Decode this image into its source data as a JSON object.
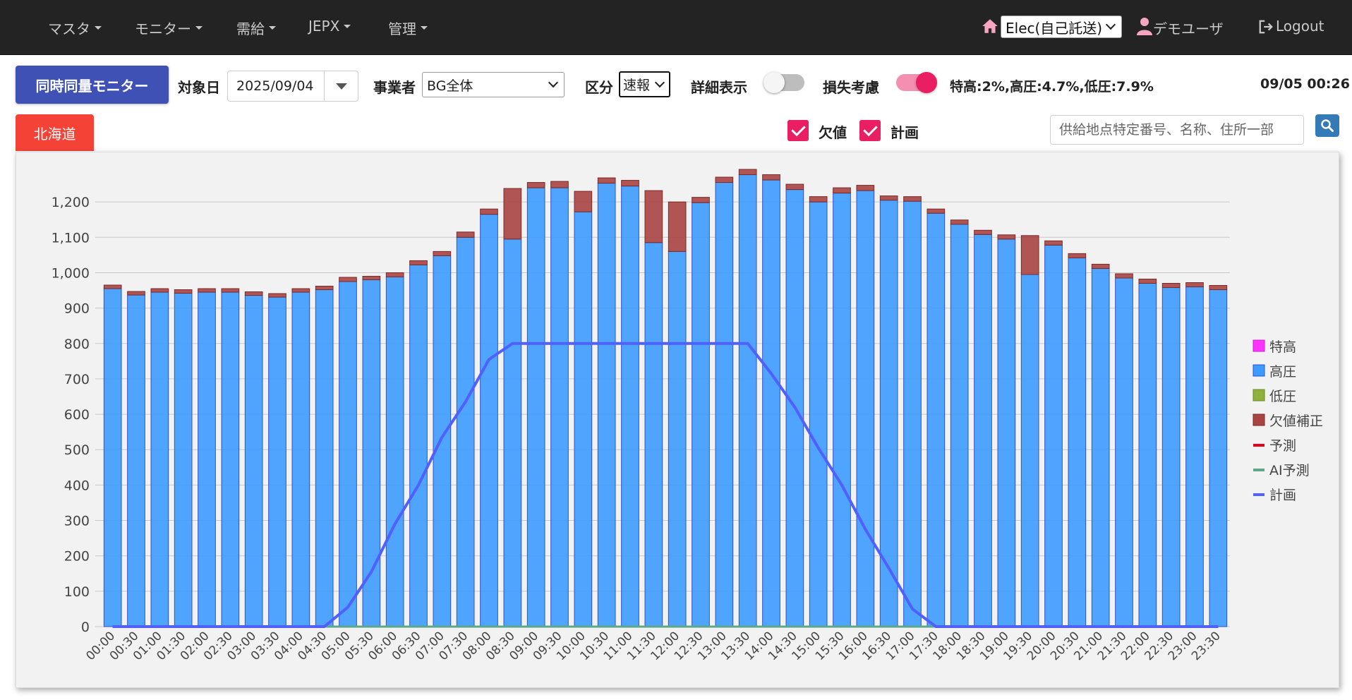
{
  "nav": {
    "menus": [
      "マスタ",
      "モニター",
      "需給",
      "JEPX",
      "管理"
    ],
    "company": "Elec(自己託送)",
    "user": "デモユーザ",
    "logout": "Logout"
  },
  "toolbar": {
    "monitor_button": "同時同量モニター",
    "date_label": "対象日",
    "date_value": "2025/09/04",
    "operator_label": "事業者",
    "operator_value": "BG全体",
    "kubun_label": "区分",
    "kubun_value": "速報",
    "detail_label": "詳細表示",
    "detail_on": false,
    "loss_label": "損失考慮",
    "loss_on": true,
    "loss_rates": "特高:2%,高圧:4.7%,低圧:7.9%",
    "current_time": "09/05 00:26"
  },
  "filters": {
    "region_tab": "北海道",
    "missing_label": "欠値",
    "missing_checked": true,
    "plan_label": "計画",
    "plan_checked": true,
    "search_placeholder": "供給地点特定番号、名称、住所一部"
  },
  "colors": {
    "nav_bg": "#232323",
    "primary": "#3f51b5",
    "region_tab": "#f44336",
    "accent": "#e91e63",
    "tokko": "#ff33ff",
    "koatsu": "#3d9bff",
    "teiatsu": "#8db33a",
    "kesson": "#a94442",
    "yosoku": "#e8001b",
    "ai_yosoku": "#5ba88a",
    "keikaku": "#5060ff"
  },
  "chart_data": {
    "type": "bar",
    "ylim": [
      0,
      1300
    ],
    "yticks": [
      0,
      100,
      200,
      300,
      400,
      500,
      600,
      700,
      800,
      900,
      1000,
      1100,
      1200
    ],
    "categories": [
      "00:00",
      "00:30",
      "01:00",
      "01:30",
      "02:00",
      "02:30",
      "03:00",
      "03:30",
      "04:00",
      "04:30",
      "05:00",
      "05:30",
      "06:00",
      "06:30",
      "07:00",
      "07:30",
      "08:00",
      "08:30",
      "09:00",
      "09:30",
      "10:00",
      "10:30",
      "11:00",
      "11:30",
      "12:00",
      "12:30",
      "13:00",
      "13:30",
      "14:00",
      "14:30",
      "15:00",
      "15:30",
      "16:00",
      "16:30",
      "17:00",
      "17:30",
      "18:00",
      "18:30",
      "19:00",
      "19:30",
      "20:00",
      "20:30",
      "21:00",
      "21:30",
      "22:00",
      "22:30",
      "23:00",
      "23:30"
    ],
    "series": [
      {
        "name": "特高",
        "kind": "bar",
        "color": "#ff33ff",
        "values": [
          0,
          0,
          0,
          0,
          0,
          0,
          0,
          0,
          0,
          0,
          0,
          0,
          0,
          0,
          0,
          0,
          0,
          0,
          0,
          0,
          0,
          0,
          0,
          0,
          0,
          0,
          0,
          0,
          0,
          0,
          0,
          0,
          0,
          0,
          0,
          0,
          0,
          0,
          0,
          0,
          0,
          0,
          0,
          0,
          0,
          0,
          0,
          0
        ]
      },
      {
        "name": "高圧",
        "kind": "bar",
        "color": "#3d9bff",
        "values": [
          955,
          937,
          945,
          942,
          945,
          945,
          936,
          931,
          945,
          952,
          975,
          980,
          988,
          1022,
          1048,
          1100,
          1165,
          1095,
          1240,
          1240,
          1172,
          1253,
          1245,
          1085,
          1060,
          1198,
          1255,
          1277,
          1262,
          1235,
          1200,
          1225,
          1232,
          1205,
          1202,
          1168,
          1137,
          1108,
          1095,
          995,
          1078,
          1042,
          1012,
          985,
          970,
          958,
          960,
          952
        ]
      },
      {
        "name": "低圧",
        "kind": "bar",
        "color": "#8db33a",
        "values": [
          0,
          0,
          0,
          0,
          0,
          0,
          0,
          0,
          0,
          0,
          0,
          0,
          0,
          0,
          0,
          0,
          0,
          0,
          0,
          0,
          0,
          0,
          0,
          0,
          0,
          0,
          0,
          0,
          0,
          0,
          0,
          0,
          0,
          0,
          0,
          0,
          0,
          0,
          0,
          0,
          0,
          0,
          0,
          0,
          0,
          0,
          0,
          0
        ]
      },
      {
        "name": "欠値補正",
        "kind": "bar",
        "color": "#a94442",
        "values": [
          10,
          10,
          10,
          10,
          10,
          10,
          10,
          10,
          10,
          10,
          12,
          10,
          12,
          12,
          12,
          15,
          15,
          143,
          15,
          18,
          58,
          15,
          16,
          147,
          140,
          15,
          15,
          15,
          15,
          15,
          15,
          15,
          15,
          12,
          13,
          12,
          12,
          12,
          12,
          110,
          12,
          12,
          12,
          12,
          12,
          12,
          12,
          12
        ]
      },
      {
        "name": "予測",
        "kind": "line",
        "color": "#e8001b",
        "values": [
          0,
          0,
          0,
          0,
          0,
          0,
          0,
          0,
          0,
          0,
          0,
          0,
          0,
          0,
          0,
          0,
          0,
          0,
          0,
          0,
          0,
          0,
          0,
          0,
          0,
          0,
          0,
          0,
          0,
          0,
          0,
          0,
          0,
          0,
          0,
          0,
          0,
          0,
          0,
          0,
          0,
          0,
          0,
          0,
          0,
          0,
          0,
          0
        ]
      },
      {
        "name": "AI予測",
        "kind": "line",
        "color": "#5ba88a",
        "values": [
          0,
          0,
          0,
          0,
          0,
          0,
          0,
          0,
          0,
          0,
          0,
          0,
          0,
          0,
          0,
          0,
          0,
          0,
          0,
          0,
          0,
          0,
          0,
          0,
          0,
          0,
          0,
          0,
          0,
          0,
          0,
          0,
          0,
          0,
          0,
          0,
          0,
          0,
          0,
          0,
          0,
          0,
          0,
          0,
          0,
          0,
          0,
          0
        ]
      },
      {
        "name": "計画",
        "kind": "line",
        "color": "#5060ff",
        "values": [
          0,
          0,
          0,
          0,
          0,
          0,
          0,
          0,
          0,
          0,
          55,
          155,
          290,
          400,
          535,
          635,
          755,
          800,
          800,
          800,
          800,
          800,
          800,
          800,
          800,
          800,
          800,
          800,
          715,
          620,
          505,
          400,
          275,
          165,
          50,
          0,
          0,
          0,
          0,
          0,
          0,
          0,
          0,
          0,
          0,
          0,
          0,
          0
        ]
      }
    ],
    "legend_position": "right"
  }
}
